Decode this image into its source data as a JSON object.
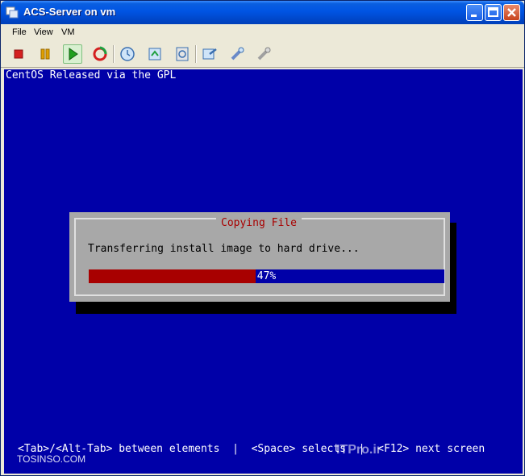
{
  "window": {
    "title": "ACS-Server on vm"
  },
  "menu": {
    "file": "File",
    "view": "View",
    "vm": "VM"
  },
  "toolbar": {
    "icons": [
      "stop-icon",
      "pause-icon",
      "play-icon",
      "reset-icon",
      "snapshot-icon",
      "revert-snapshot-icon",
      "snapshot-manager-icon",
      "settings-icon",
      "tools-icon",
      "connect-icon"
    ],
    "colors": {
      "stop": "#d42020",
      "pause": "#e0a000",
      "play": "#20a020",
      "reset": "#20a040"
    }
  },
  "console": {
    "top_line": "CentOS Released via the GPL",
    "dialog": {
      "title": "Copying File",
      "message": "Transferring install image to hard drive...",
      "progress_percent": 47,
      "progress_label": "47%"
    },
    "help_line": "<Tab>/<Alt-Tab> between elements  |  <Space> selects  |  <F12> next screen",
    "watermark_left": "TOSINSO.COM",
    "watermark_right": "ITPro.ir",
    "colors": {
      "background": "#0000a8",
      "dialog": "#a8a8a8",
      "title": "#a80000",
      "progress_fill": "#a80000"
    }
  }
}
